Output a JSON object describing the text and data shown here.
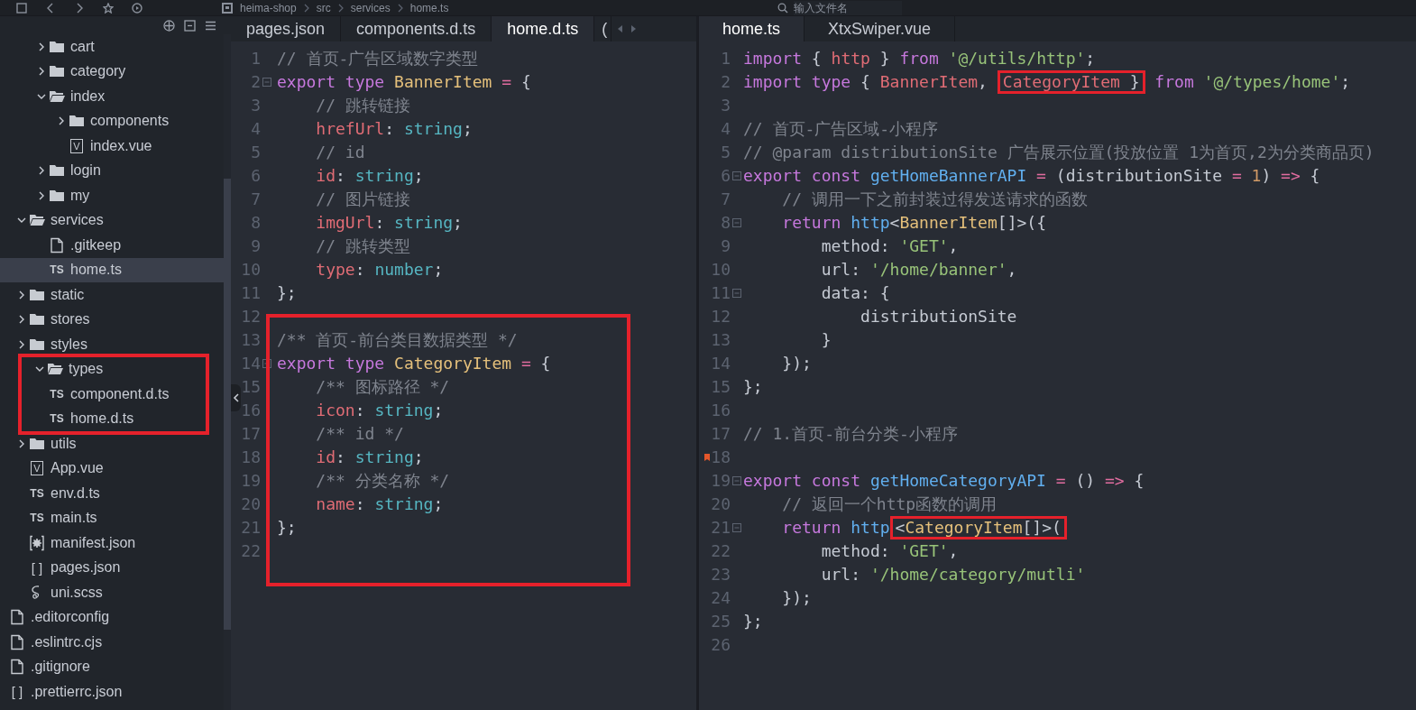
{
  "toolbar": {
    "breadcrumb": [
      "heima-shop",
      "src",
      "services",
      "home.ts"
    ],
    "search": {
      "placeholder": "输入文件名"
    }
  },
  "sidebar": {
    "tree": [
      {
        "children": [
          {
            "children": [
              {
                "label": "cart",
                "kind": "folder",
                "expanded": false,
                "selected": false
              },
              {
                "label": "category",
                "kind": "folder",
                "expanded": false,
                "selected": false
              },
              {
                "label": "index",
                "kind": "folder",
                "expanded": true,
                "selected": false,
                "children": [
                  {
                    "label": "components",
                    "kind": "folder",
                    "expanded": false,
                    "selected": false
                  },
                  {
                    "label": "index.vue",
                    "kind": "vue",
                    "badge": "V",
                    "selected": false
                  }
                ]
              },
              {
                "label": "login",
                "kind": "folder",
                "expanded": false,
                "selected": false
              },
              {
                "label": "my",
                "kind": "folder",
                "expanded": false,
                "selected": false
              }
            ]
          },
          {
            "label": "services",
            "kind": "folder",
            "expanded": true,
            "selected": false,
            "children": [
              {
                "label": ".gitkeep",
                "kind": "file",
                "selected": false
              },
              {
                "label": "home.ts",
                "kind": "ts",
                "badge": "TS",
                "selected": true
              }
            ]
          },
          {
            "label": "static",
            "kind": "folder",
            "expanded": false,
            "selected": false
          },
          {
            "label": "stores",
            "kind": "folder",
            "expanded": false,
            "selected": false
          },
          {
            "label": "styles",
            "kind": "folder",
            "expanded": false,
            "selected": false
          },
          {
            "label": "types",
            "kind": "folder",
            "expanded": true,
            "selected": false,
            "boxed": true,
            "children": [
              {
                "label": "component.d.ts",
                "kind": "ts",
                "badge": "TS",
                "selected": false
              },
              {
                "label": "home.d.ts",
                "kind": "ts",
                "badge": "TS",
                "selected": false
              }
            ]
          },
          {
            "label": "utils",
            "kind": "folder",
            "expanded": false,
            "selected": false
          },
          {
            "label": "App.vue",
            "kind": "vue",
            "badge": "V",
            "selected": false
          },
          {
            "label": "env.d.ts",
            "kind": "ts",
            "badge": "TS",
            "selected": false
          },
          {
            "label": "main.ts",
            "kind": "ts",
            "badge": "TS",
            "selected": false
          },
          {
            "label": "manifest.json",
            "kind": "settings",
            "selected": false
          },
          {
            "label": "pages.json",
            "kind": "json",
            "badge": "[ ]",
            "selected": false
          },
          {
            "label": "uni.scss",
            "kind": "scss",
            "selected": false
          }
        ]
      },
      {
        "label": ".editorconfig",
        "kind": "file",
        "selected": false
      },
      {
        "label": ".eslintrc.cjs",
        "kind": "file",
        "selected": false
      },
      {
        "label": ".gitignore",
        "kind": "file",
        "selected": false
      },
      {
        "label": ".prettierrc.json",
        "kind": "json",
        "badge": "[ ]",
        "selected": false
      }
    ]
  },
  "editors": [
    {
      "tabs": [
        {
          "label": "pages.json",
          "selected": false
        },
        {
          "label": "components.d.ts",
          "selected": false
        },
        {
          "label": "home.d.ts",
          "selected": true
        },
        {
          "label": "(",
          "selected": false
        }
      ],
      "lines": [
        {
          "number": "1",
          "tokens": [
            {
              "t": "// 首页-广告区域数字类型",
              "kind": "cmt"
            }
          ]
        },
        {
          "number": "2",
          "fold": true,
          "tokens": [
            {
              "t": "export ",
              "kind": "kw"
            },
            {
              "t": "type ",
              "kind": "kw"
            },
            {
              "t": "BannerItem",
              "kind": "cls"
            },
            {
              "t": " = ",
              "kind": "op"
            },
            {
              "t": "{",
              "kind": "txt"
            }
          ]
        },
        {
          "number": "3",
          "tokens": [
            {
              "t": "    // 跳转链接",
              "kind": "cmt"
            }
          ]
        },
        {
          "number": "4",
          "tokens": [
            {
              "t": "    hrefUrl",
              "kind": "prop"
            },
            {
              "t": ": ",
              "kind": "txt"
            },
            {
              "t": "string",
              "kind": "type"
            },
            {
              "t": ";",
              "kind": "txt"
            }
          ]
        },
        {
          "number": "5",
          "tokens": [
            {
              "t": "    // id",
              "kind": "cmt"
            }
          ]
        },
        {
          "number": "6",
          "tokens": [
            {
              "t": "    id",
              "kind": "prop"
            },
            {
              "t": ": ",
              "kind": "txt"
            },
            {
              "t": "string",
              "kind": "type"
            },
            {
              "t": ";",
              "kind": "txt"
            }
          ]
        },
        {
          "number": "7",
          "tokens": [
            {
              "t": "    // 图片链接",
              "kind": "cmt"
            }
          ]
        },
        {
          "number": "8",
          "tokens": [
            {
              "t": "    imgUrl",
              "kind": "prop"
            },
            {
              "t": ": ",
              "kind": "txt"
            },
            {
              "t": "string",
              "kind": "type"
            },
            {
              "t": ";",
              "kind": "txt"
            }
          ]
        },
        {
          "number": "9",
          "tokens": [
            {
              "t": "    // 跳转类型",
              "kind": "cmt"
            }
          ]
        },
        {
          "number": "10",
          "tokens": [
            {
              "t": "    type",
              "kind": "prop"
            },
            {
              "t": ": ",
              "kind": "txt"
            },
            {
              "t": "number",
              "kind": "type"
            },
            {
              "t": ";",
              "kind": "txt"
            }
          ]
        },
        {
          "number": "11",
          "tokens": [
            {
              "t": "};",
              "kind": "txt"
            }
          ]
        }
      ],
      "highlighted": {
        "lines": [
          {
            "number": "12"
          },
          {
            "number": "13",
            "tokens": [
              {
                "t": "/** 首页-前台类目数据类型 */",
                "kind": "cmt"
              }
            ]
          },
          {
            "number": "14",
            "fold": true,
            "tokens": [
              {
                "t": "export ",
                "kind": "kw"
              },
              {
                "t": "type ",
                "kind": "kw"
              },
              {
                "t": "CategoryItem",
                "kind": "cls"
              },
              {
                "t": " = ",
                "kind": "op"
              },
              {
                "t": "{",
                "kind": "txt"
              }
            ]
          },
          {
            "number": "15",
            "tokens": [
              {
                "t": "    /** 图标路径 */",
                "kind": "cmt"
              }
            ]
          },
          {
            "number": "16",
            "tokens": [
              {
                "t": "    icon",
                "kind": "prop"
              },
              {
                "t": ": ",
                "kind": "txt"
              },
              {
                "t": "string",
                "kind": "type"
              },
              {
                "t": ";",
                "kind": "txt"
              }
            ]
          },
          {
            "number": "17",
            "tokens": [
              {
                "t": "    /** id */",
                "kind": "cmt"
              }
            ]
          },
          {
            "number": "18",
            "tokens": [
              {
                "t": "    id",
                "kind": "prop"
              },
              {
                "t": ": ",
                "kind": "txt"
              },
              {
                "t": "string",
                "kind": "type"
              },
              {
                "t": ";",
                "kind": "txt"
              }
            ]
          },
          {
            "number": "19",
            "tokens": [
              {
                "t": "    /** 分类名称 */",
                "kind": "cmt"
              }
            ]
          },
          {
            "number": "20",
            "tokens": [
              {
                "t": "    name",
                "kind": "prop"
              },
              {
                "t": ": ",
                "kind": "txt"
              },
              {
                "t": "string",
                "kind": "type"
              },
              {
                "t": ";",
                "kind": "txt"
              }
            ]
          },
          {
            "number": "21",
            "tokens": [
              {
                "t": "};",
                "kind": "txt"
              }
            ]
          },
          {
            "number": "22"
          }
        ]
      }
    },
    {
      "tabs": [
        {
          "label": "home.ts",
          "selected": true
        },
        {
          "label": "XtxSwiper.vue",
          "selected": false
        }
      ],
      "lines": [
        {
          "number": "1",
          "tokens": [
            {
              "t": "import",
              "kind": "kw"
            },
            {
              "t": " { ",
              "kind": "txt"
            },
            {
              "t": "http",
              "kind": "prop"
            },
            {
              "t": " } ",
              "kind": "txt"
            },
            {
              "t": "from ",
              "kind": "kw"
            },
            {
              "t": "'@/utils/http'",
              "kind": "str"
            },
            {
              "t": ";",
              "kind": "txt"
            }
          ]
        },
        {
          "number": "2",
          "tokens": [
            {
              "t": "import ",
              "kind": "kw"
            },
            {
              "t": "type ",
              "kind": "kw"
            },
            {
              "t": "{ ",
              "kind": "txt"
            },
            {
              "t": "BannerItem",
              "kind": "prop"
            },
            {
              "t": ", ",
              "kind": "txt"
            },
            {
              "boxed": true,
              "parts": [
                {
                  "t": "CategoryItem",
                  "kind": "prop"
                },
                {
                  "t": " }",
                  "kind": "txt"
                }
              ]
            },
            {
              "t": " from ",
              "kind": "kw"
            },
            {
              "t": "'@/types/home'",
              "kind": "str"
            },
            {
              "t": ";",
              "kind": "txt"
            }
          ]
        },
        {
          "number": "3"
        },
        {
          "number": "4",
          "tokens": [
            {
              "t": "// 首页-广告区域-小程序",
              "kind": "cmt"
            }
          ]
        },
        {
          "number": "5",
          "tokens": [
            {
              "t": "// @param distributionSite 广告展示位置(投放位置 1为首页,2为分类商品页)",
              "kind": "cmt"
            }
          ]
        },
        {
          "number": "6",
          "fold": true,
          "tokens": [
            {
              "t": "export ",
              "kind": "kw"
            },
            {
              "t": "const ",
              "kind": "kw"
            },
            {
              "t": "getHomeBannerAPI",
              "kind": "fn"
            },
            {
              "t": " = ",
              "kind": "op"
            },
            {
              "t": "(distributionSite ",
              "kind": "txt"
            },
            {
              "t": "= ",
              "kind": "op"
            },
            {
              "t": "1",
              "kind": "num"
            },
            {
              "t": ") ",
              "kind": "txt"
            },
            {
              "t": "=> ",
              "kind": "op"
            },
            {
              "t": "{",
              "kind": "txt"
            }
          ]
        },
        {
          "number": "7",
          "tokens": [
            {
              "t": "    // 调用一下之前封装过得发送请求的函数",
              "kind": "cmt"
            }
          ]
        },
        {
          "number": "8",
          "fold": true,
          "tokens": [
            {
              "t": "    return ",
              "kind": "kw"
            },
            {
              "t": "http",
              "kind": "fn"
            },
            {
              "t": "<",
              "kind": "txt"
            },
            {
              "t": "BannerItem",
              "kind": "cls"
            },
            {
              "t": "[]>({",
              "kind": "txt"
            }
          ]
        },
        {
          "number": "9",
          "tokens": [
            {
              "t": "        method: ",
              "kind": "txt"
            },
            {
              "t": "'GET'",
              "kind": "str"
            },
            {
              "t": ",",
              "kind": "txt"
            }
          ]
        },
        {
          "number": "10",
          "tokens": [
            {
              "t": "        url: ",
              "kind": "txt"
            },
            {
              "t": "'/home/banner'",
              "kind": "str"
            },
            {
              "t": ",",
              "kind": "txt"
            }
          ]
        },
        {
          "number": "11",
          "fold": true,
          "tokens": [
            {
              "t": "        data: {",
              "kind": "txt"
            }
          ]
        },
        {
          "number": "12",
          "tokens": [
            {
              "t": "            distributionSite",
              "kind": "txt"
            }
          ]
        },
        {
          "number": "13",
          "tokens": [
            {
              "t": "        }",
              "kind": "txt"
            }
          ]
        },
        {
          "number": "14",
          "tokens": [
            {
              "t": "    });",
              "kind": "txt"
            }
          ]
        },
        {
          "number": "15",
          "tokens": [
            {
              "t": "};",
              "kind": "txt"
            }
          ]
        },
        {
          "number": "16"
        },
        {
          "number": "17",
          "tokens": [
            {
              "t": "// 1.首页-前台分类-小程序",
              "kind": "cmt"
            }
          ]
        },
        {
          "number": "18",
          "marker": true
        },
        {
          "number": "19",
          "fold": true,
          "tokens": [
            {
              "t": "export ",
              "kind": "kw"
            },
            {
              "t": "const ",
              "kind": "kw"
            },
            {
              "t": "getHomeCategoryAPI",
              "kind": "fn"
            },
            {
              "t": " = ",
              "kind": "op"
            },
            {
              "t": "() ",
              "kind": "txt"
            },
            {
              "t": "=> ",
              "kind": "op"
            },
            {
              "t": "{",
              "kind": "txt"
            }
          ]
        },
        {
          "number": "20",
          "tokens": [
            {
              "t": "    // 返回一个http函数的调用",
              "kind": "cmt"
            }
          ]
        },
        {
          "number": "21",
          "fold": true,
          "tokens": [
            {
              "t": "    return ",
              "kind": "kw"
            },
            {
              "t": "http",
              "kind": "fn"
            },
            {
              "boxed": true,
              "parts": [
                {
                  "t": "<",
                  "kind": "txt"
                },
                {
                  "t": "CategoryItem",
                  "kind": "cls"
                },
                {
                  "t": "[]>(",
                  "kind": "txt"
                }
              ]
            }
          ]
        },
        {
          "number": "22",
          "tokens": [
            {
              "t": "        method: ",
              "kind": "txt"
            },
            {
              "t": "'GET'",
              "kind": "str"
            },
            {
              "t": ",",
              "kind": "txt"
            }
          ]
        },
        {
          "number": "23",
          "tokens": [
            {
              "t": "        url: ",
              "kind": "txt"
            },
            {
              "t": "'/home/category/mutli'",
              "kind": "str"
            }
          ]
        },
        {
          "number": "24",
          "tokens": [
            {
              "t": "    });",
              "kind": "txt"
            }
          ]
        },
        {
          "number": "25",
          "tokens": [
            {
              "t": "};",
              "kind": "txt"
            }
          ]
        },
        {
          "number": "26"
        }
      ]
    }
  ]
}
